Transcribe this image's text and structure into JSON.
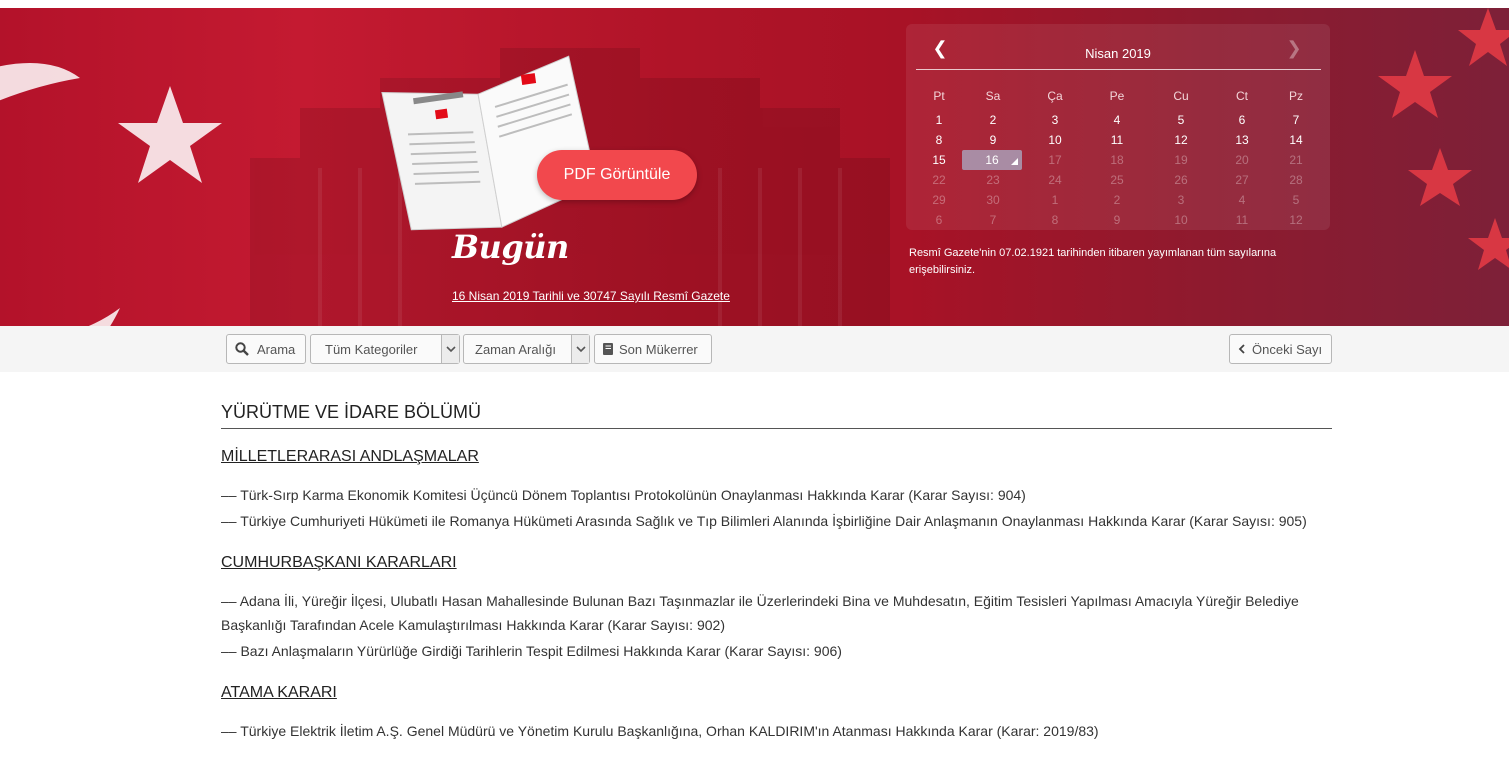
{
  "hero": {
    "pdf_button": "PDF Görüntüle",
    "today_title": "Bugün",
    "today_link": "16 Nisan 2019 Tarihli ve 30747 Sayılı Resmî Gazete",
    "info_text": "Resmî Gazete'nin 07.02.1921 tarihinden itibaren yayımlanan tüm sayılarına erişebilirsiniz."
  },
  "calendar": {
    "month": "Nisan 2019",
    "weekdays": [
      "Pt",
      "Sa",
      "Ça",
      "Pe",
      "Cu",
      "Ct",
      "Pz"
    ],
    "weeks": [
      [
        "1",
        "2",
        "3",
        "4",
        "5",
        "6",
        "7"
      ],
      [
        "8",
        "9",
        "10",
        "11",
        "12",
        "13",
        "14"
      ],
      [
        "15",
        "16",
        "17",
        "18",
        "19",
        "20",
        "21"
      ],
      [
        "22",
        "23",
        "24",
        "25",
        "26",
        "27",
        "28"
      ],
      [
        "29",
        "30",
        "1",
        "2",
        "3",
        "4",
        "5"
      ],
      [
        "6",
        "7",
        "8",
        "9",
        "10",
        "11",
        "12"
      ]
    ],
    "selected_day": "16"
  },
  "toolbar": {
    "search": "Arama",
    "categories": "Tüm Kategoriler",
    "time_range": "Zaman Aralığı",
    "last_duplicate": "Son Mükerrer",
    "previous_issue": "Önceki Sayı"
  },
  "content": {
    "section_title": "YÜRÜTME VE İDARE BÖLÜMÜ",
    "categories": [
      {
        "name": "MİLLETLERARASI ANDLAŞMALAR",
        "items": [
          "–– Türk-Sırp Karma Ekonomik Komitesi Üçüncü Dönem Toplantısı Protokolünün Onaylanması Hakkında Karar (Karar Sayısı: 904)",
          "–– Türkiye Cumhuriyeti Hükümeti ile Romanya Hükümeti Arasında Sağlık ve Tıp Bilimleri Alanında İşbirliğine Dair Anlaşmanın Onaylanması Hakkında Karar (Karar Sayısı: 905)"
        ]
      },
      {
        "name": "CUMHURBAŞKANI KARARLARI",
        "items": [
          "–– Adana İli, Yüreğir İlçesi, Ulubatlı Hasan Mahallesinde Bulunan Bazı Taşınmazlar ile Üzerlerindeki Bina ve Muhdesatın, Eğitim Tesisleri Yapılması Amacıyla Yüreğir Belediye Başkanlığı Tarafından Acele Kamulaştırılması Hakkında Karar (Karar Sayısı: 902)",
          "–– Bazı Anlaşmaların Yürürlüğe Girdiği Tarihlerin Tespit Edilmesi Hakkında Karar (Karar Sayısı: 906)"
        ]
      },
      {
        "name": "ATAMA KARARI",
        "items": [
          "–– Türkiye Elektrik İletim A.Ş. Genel Müdürü ve Yönetim Kurulu Başkanlığına, Orhan KALDIRIM'ın Atanması Hakkında Karar (Karar: 2019/83)"
        ]
      }
    ]
  }
}
